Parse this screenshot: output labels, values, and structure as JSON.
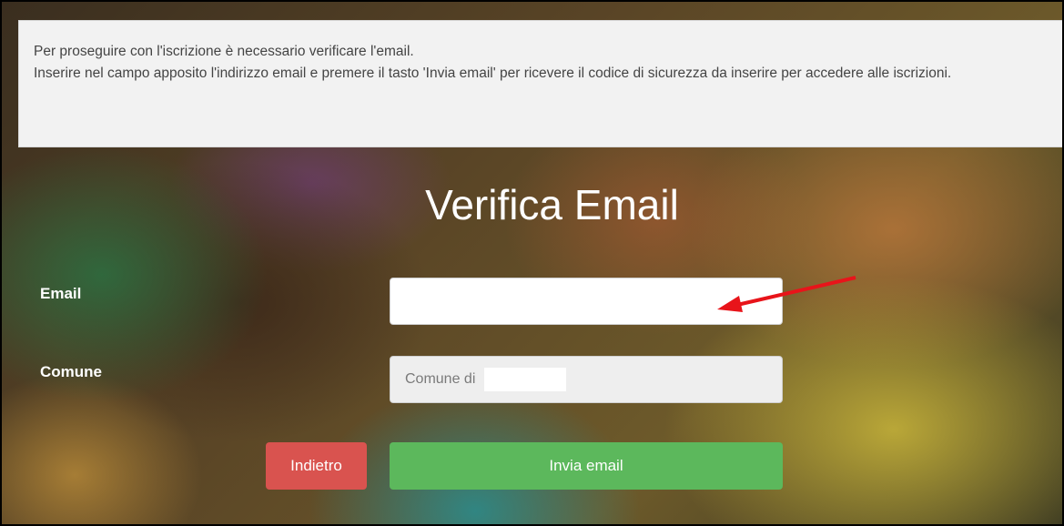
{
  "info": {
    "line1": "Per proseguire con l'iscrizione è necessario verificare l'email.",
    "line2": "Inserire nel campo apposito l'indirizzo email e premere il tasto 'Invia email' per ricevere il codice di sicurezza da inserire per accedere alle iscrizioni."
  },
  "form": {
    "title": "Verifica Email",
    "email_label": "Email",
    "email_value": "",
    "comune_label": "Comune",
    "comune_value": "Comune di"
  },
  "buttons": {
    "back_label": "Indietro",
    "send_label": "Invia email"
  },
  "colors": {
    "back_button": "#d9534f",
    "send_button": "#5cb85c",
    "annotation_arrow": "#e8141a"
  }
}
